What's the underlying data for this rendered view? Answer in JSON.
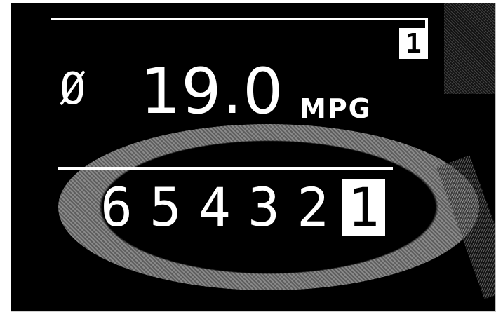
{
  "top_badge": {
    "gear": "1"
  },
  "average_consumption": {
    "symbol": "Ø",
    "value": "19.0",
    "unit": "MPG"
  },
  "gear_indicator": {
    "gears": [
      "6",
      "5",
      "4",
      "3",
      "2",
      "1"
    ],
    "active_gear": "1"
  },
  "colors": {
    "display_background": "#000000",
    "display_foreground": "#ffffff",
    "highlight_ring": "#7a7a7a"
  }
}
